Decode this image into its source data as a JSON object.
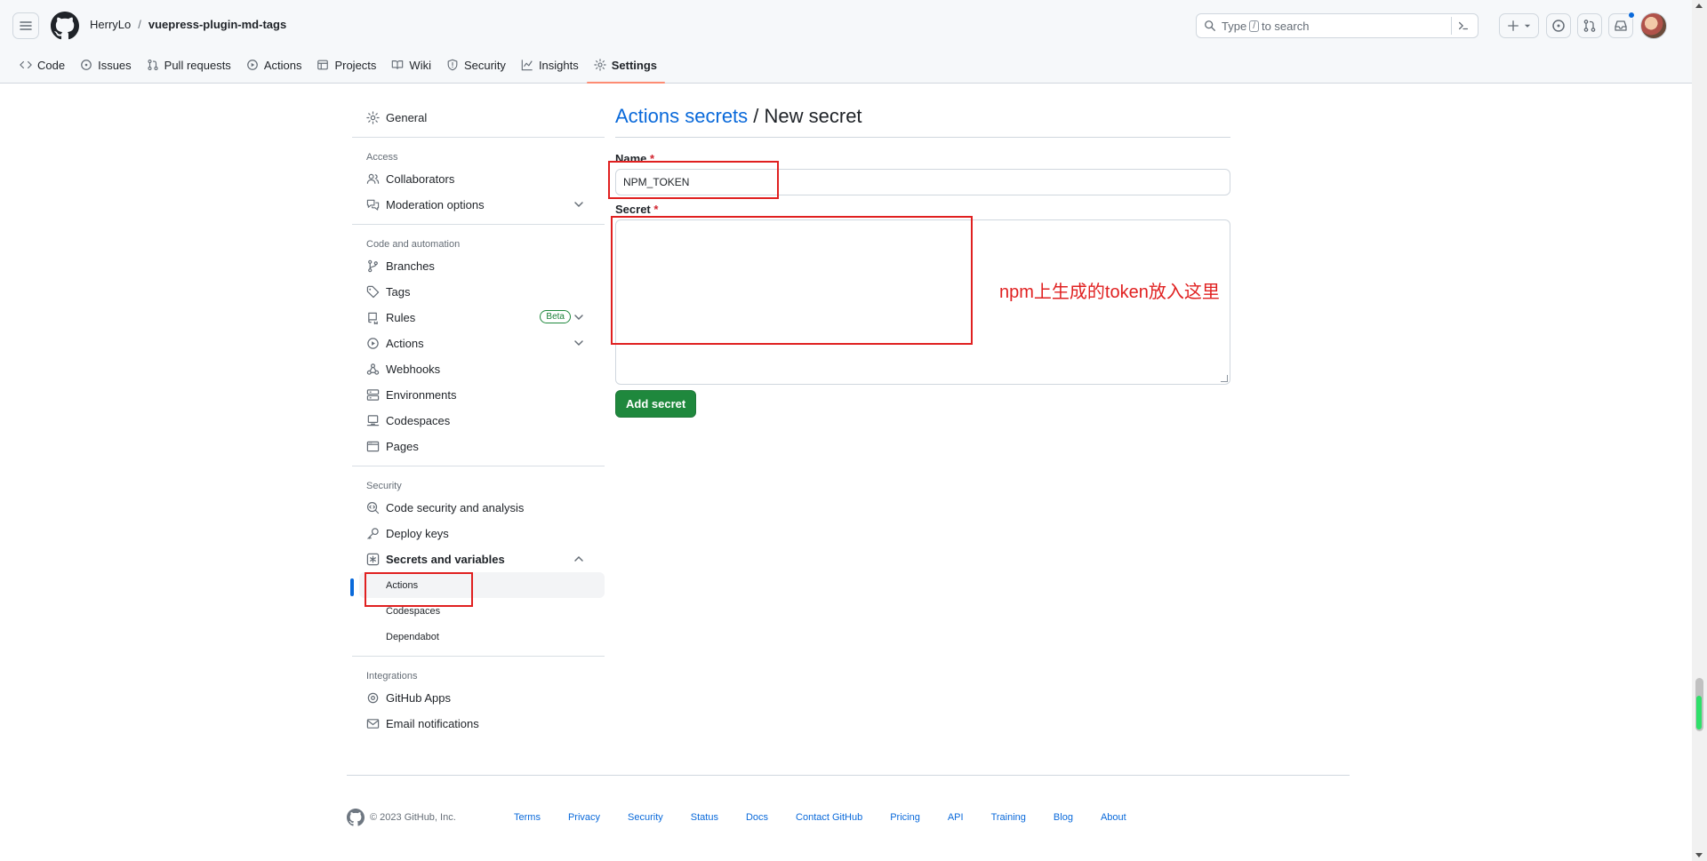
{
  "header": {
    "owner": "HerryLo",
    "separator": "/",
    "repo": "vuepress-plugin-md-tags",
    "search": {
      "prefix": "Type",
      "key": "/",
      "suffix": "to search"
    }
  },
  "tabs": [
    {
      "label": "Code",
      "icon": "code-icon"
    },
    {
      "label": "Issues",
      "icon": "issue-icon"
    },
    {
      "label": "Pull requests",
      "icon": "pull-request-icon"
    },
    {
      "label": "Actions",
      "icon": "play-icon"
    },
    {
      "label": "Projects",
      "icon": "table-icon"
    },
    {
      "label": "Wiki",
      "icon": "book-icon"
    },
    {
      "label": "Security",
      "icon": "shield-icon"
    },
    {
      "label": "Insights",
      "icon": "graph-icon"
    },
    {
      "label": "Settings",
      "icon": "gear-icon",
      "selected": true
    }
  ],
  "sidebar": {
    "general": "General",
    "access_heading": "Access",
    "collaborators": "Collaborators",
    "moderation": "Moderation options",
    "code_heading": "Code and automation",
    "branches": "Branches",
    "tags": "Tags",
    "rules": "Rules",
    "beta": "Beta",
    "actions": "Actions",
    "webhooks": "Webhooks",
    "environments": "Environments",
    "codespaces": "Codespaces",
    "pages": "Pages",
    "security_heading": "Security",
    "code_security": "Code security and analysis",
    "deploy_keys": "Deploy keys",
    "secrets": "Secrets and variables",
    "sub_actions": "Actions",
    "sub_codespaces": "Codespaces",
    "sub_dependabot": "Dependabot",
    "integrations_heading": "Integrations",
    "github_apps": "GitHub Apps",
    "email_notifications": "Email notifications"
  },
  "main": {
    "title_link": "Actions secrets",
    "title_sep": " / ",
    "title_rest": "New secret",
    "name_label": "Name",
    "required_mark": "*",
    "name_value": "NPM_TOKEN",
    "secret_label": "Secret",
    "submit": "Add secret"
  },
  "annotation": "npm上生成的token放入这里",
  "colors": {
    "annotation_red": "#e02020",
    "primary_green": "#1f883d",
    "link_blue": "#0969da",
    "tab_underline": "#fd8c73"
  },
  "footer": {
    "copyright": "© 2023 GitHub, Inc.",
    "links": [
      "Terms",
      "Privacy",
      "Security",
      "Status",
      "Docs",
      "Contact GitHub",
      "Pricing",
      "API",
      "Training",
      "Blog",
      "About"
    ]
  }
}
